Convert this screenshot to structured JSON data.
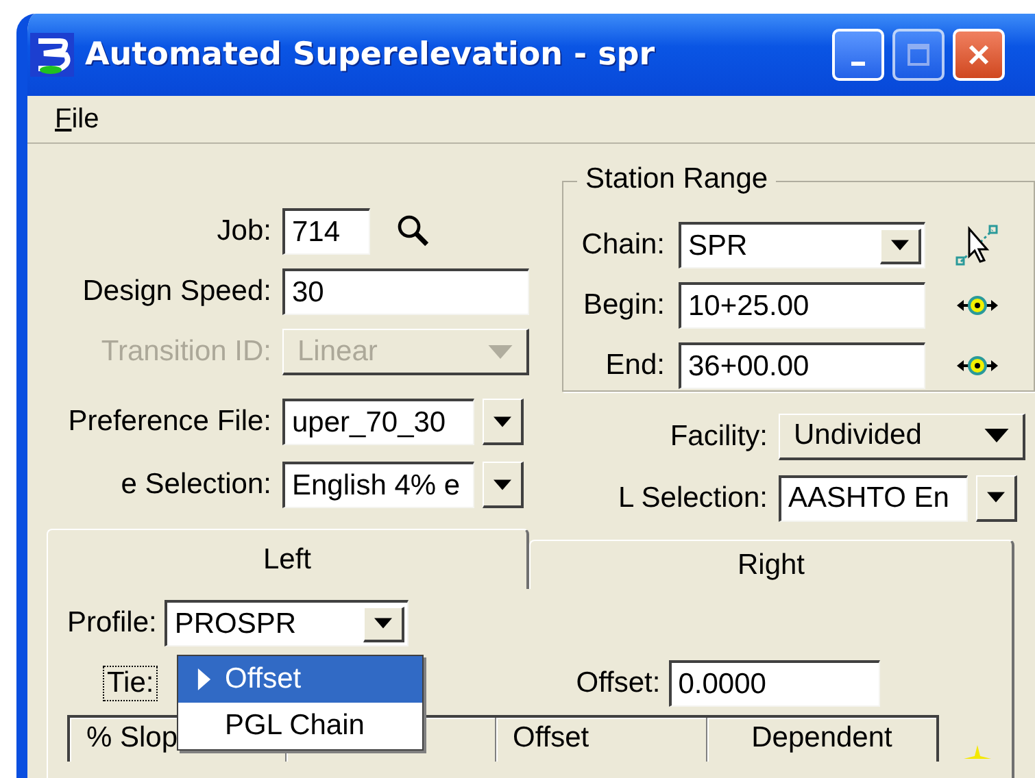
{
  "window": {
    "title": "Automated Superelevation - spr"
  },
  "menu": [
    "File"
  ],
  "left_fields": [
    {
      "label": "Job:",
      "value": "714",
      "kind": "short",
      "disabled": false
    },
    {
      "label": "Design Speed:",
      "value": "30",
      "kind": "text",
      "disabled": false
    },
    {
      "label": "Transition ID:",
      "value": "Linear",
      "kind": "combo",
      "disabled": true
    }
  ],
  "left_pickers": [
    {
      "label": "Preference File:",
      "value": "uper_70_30",
      "kind": "picker",
      "disabled": false
    },
    {
      "label": "e Selection:",
      "value": "English 4% e",
      "kind": "picker",
      "disabled": false
    }
  ],
  "station_range": {
    "title": "Station Range",
    "fields": [
      {
        "label": "Chain:",
        "value": "SPR",
        "kind": "chain"
      },
      {
        "label": "Begin:",
        "value": "10+25.00",
        "kind": "station"
      },
      {
        "label": "End:",
        "value": "36+00.00",
        "kind": "station"
      }
    ]
  },
  "right_fields": [
    {
      "label": "Facility:",
      "value": "Undivided",
      "kind": "combo"
    },
    {
      "label": "L Selection:",
      "value": "AASHTO En",
      "kind": "picker"
    }
  ],
  "tabs": [
    {
      "label": "Left",
      "selected": true
    },
    {
      "label": "Right",
      "selected": false
    }
  ],
  "profile": {
    "label": "Profile:",
    "value": "PROSPR"
  },
  "tie": {
    "label": "Tie:",
    "menu": [
      {
        "label": "Offset",
        "selected": true
      },
      {
        "label": "PGL Chain",
        "selected": false
      }
    ]
  },
  "offset": {
    "label": "Offset:",
    "value": "0.0000"
  },
  "table": {
    "columns": [
      "% Slop",
      null,
      "Offset",
      "Dependent"
    ]
  }
}
